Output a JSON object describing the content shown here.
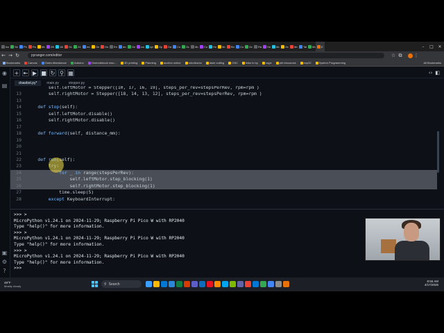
{
  "browser": {
    "tabs": [
      {
        "label": "main",
        "color": "#5f6368"
      },
      {
        "label": "Sep",
        "color": "#34a853"
      },
      {
        "label": "Pro",
        "color": "#4285f4"
      },
      {
        "label": "Rob",
        "color": "#ea4335"
      },
      {
        "label": "Mo",
        "color": "#fbbc04"
      },
      {
        "label": "280",
        "color": "#a142f4"
      },
      {
        "label": "180",
        "color": "#24c1e0"
      },
      {
        "label": "Gra",
        "color": "#ea4335"
      },
      {
        "label": "24",
        "color": "#34a853"
      },
      {
        "label": "mo",
        "color": "#4285f4"
      },
      {
        "label": "Ge",
        "color": "#fbbc04"
      },
      {
        "label": "Ho",
        "color": "#ea4335"
      },
      {
        "label": "Em",
        "color": "#5f6368"
      },
      {
        "label": "dro",
        "color": "#4285f4"
      },
      {
        "label": "Ge",
        "color": "#34a853"
      },
      {
        "label": "con",
        "color": "#a142f4"
      },
      {
        "label": "opt",
        "color": "#24c1e0"
      },
      {
        "label": "Op",
        "color": "#fbbc04"
      },
      {
        "label": "Ga",
        "color": "#ea4335"
      },
      {
        "label": "Co",
        "color": "#4285f4"
      },
      {
        "label": "Gra",
        "color": "#34a853"
      },
      {
        "label": "Mo",
        "color": "#5f6368"
      },
      {
        "label": "Co",
        "color": "#a142f4"
      },
      {
        "label": "Ho",
        "color": "#24c1e0"
      },
      {
        "label": "Mo",
        "color": "#fbbc04"
      },
      {
        "label": "Bro",
        "color": "#ea4335"
      },
      {
        "label": "Co",
        "color": "#4285f4"
      },
      {
        "label": "Gra",
        "color": "#34a853"
      },
      {
        "label": "Rai",
        "color": "#5f6368"
      },
      {
        "label": "Ho",
        "color": "#a142f4"
      },
      {
        "label": "Mo",
        "color": "#24c1e0"
      },
      {
        "label": "Gra",
        "color": "#fbbc04"
      },
      {
        "label": "Mo",
        "color": "#ea4335"
      },
      {
        "label": "Tal",
        "color": "#4285f4"
      },
      {
        "label": "Mo",
        "color": "#34a853"
      },
      {
        "label": "E",
        "color": "#e8710a"
      }
    ],
    "url": "pyranger.com/editor",
    "bookmarks": [
      {
        "label": "Bookmarks",
        "color": "#8ab4f8"
      },
      {
        "label": "Canvas",
        "color": "#ea4335"
      },
      {
        "label": "Claim Attendance",
        "color": "#4285f4"
      },
      {
        "label": "Arduino",
        "color": "#34a853"
      },
      {
        "label": "Onenotebook reso...",
        "color": "#a142f4"
      },
      {
        "label": "3D printing",
        "color": "#fbbc04"
      },
      {
        "label": "Planning",
        "color": "#fbbc04"
      },
      {
        "label": "auction online",
        "color": "#fbbc04"
      },
      {
        "label": "robotics/cs",
        "color": "#fbbc04"
      },
      {
        "label": "laser cutting",
        "color": "#fbbc04"
      },
      {
        "label": "CNC",
        "color": "#fbbc04"
      },
      {
        "label": "links to try",
        "color": "#fbbc04"
      },
      {
        "label": "ragic",
        "color": "#fbbc04"
      },
      {
        "label": "pbl resources",
        "color": "#fbbc04"
      },
      {
        "label": "esp32",
        "color": "#fbbc04"
      },
      {
        "label": "System Programming",
        "color": "#fbbc04"
      }
    ],
    "bookmarks_right": "All Bookmarks"
  },
  "editor": {
    "tabs": [
      "drawbot.py*",
      "main.py",
      "stepper.py"
    ],
    "lines": [
      {
        "n": "",
        "code": "        self.leftMotor = Stepper([10, 17, 16, 19], steps_per_rev=stepsPerRev, rpm=rpm )",
        "sel": false
      },
      {
        "n": "13",
        "code": "        self.rightMotor = Stepper([18, 14, 13, 12], steps_per_rev=stepsPerRev, rpm=rpm )",
        "sel": false
      },
      {
        "n": "13",
        "code": "",
        "sel": false
      },
      {
        "n": "14",
        "code": "    def stop(self):",
        "sel": false
      },
      {
        "n": "15",
        "code": "        self.leftMotor.disable()",
        "sel": false
      },
      {
        "n": "16",
        "code": "        self.rightMotor.disable()",
        "sel": false
      },
      {
        "n": "17",
        "code": "",
        "sel": false
      },
      {
        "n": "18",
        "code": "    def forward(self, distance_mm):",
        "sel": false
      },
      {
        "n": "19",
        "code": "",
        "sel": false
      },
      {
        "n": "20",
        "code": "",
        "sel": false
      },
      {
        "n": "21",
        "code": "",
        "sel": false
      },
      {
        "n": "22",
        "code": "    def run(self):",
        "sel": false
      },
      {
        "n": "23",
        "code": "        try:",
        "sel": false
      },
      {
        "n": "24",
        "code": "            for _ in range(stepsPerRev):",
        "sel": true
      },
      {
        "n": "25",
        "code": "                self.leftMotor.step_blocking(1)",
        "sel": true
      },
      {
        "n": "26",
        "code": "                self.rightMotor.step_blocking(1)",
        "sel": true
      },
      {
        "n": "27",
        "code": "            time.sleep(5)",
        "sel": false
      },
      {
        "n": "28",
        "code": "        except KeyboardInterrupt:",
        "sel": false
      }
    ]
  },
  "shell": {
    "lines": [
      ">>> >",
      "MicroPython v1.24.1 on 2024-11-29; Raspberry Pi Pico W with RP2040",
      "Type \"help()\" for more information.",
      ">>> >",
      "MicroPython v1.24.1 on 2024-11-29; Raspberry Pi Pico W with RP2040",
      "Type \"help()\" for more information.",
      ">>> >",
      "MicroPython v1.24.1 on 2024-11-29; Raspberry Pi Pico W with RP2040",
      "Type \"help()\" for more information.",
      ">>> "
    ]
  },
  "taskbar": {
    "weather_temp": "49°F",
    "weather_desc": "Mostly cloudy",
    "search_placeholder": "Search",
    "time": "8:56 AM",
    "date": "4/17/2025",
    "icons": [
      "#3aa0ff",
      "#ffb900",
      "#0078d4",
      "#2b88d8",
      "#107c41",
      "#d83b01",
      "#5b5fc7",
      "#0f6cbd",
      "#e81123",
      "#ff8c00",
      "#00a4ef",
      "#7fba00",
      "#6264a7",
      "#ea4335",
      "#0078d4",
      "#34a853",
      "#4285f4",
      "#8c8c8c",
      "#e8710a"
    ]
  }
}
